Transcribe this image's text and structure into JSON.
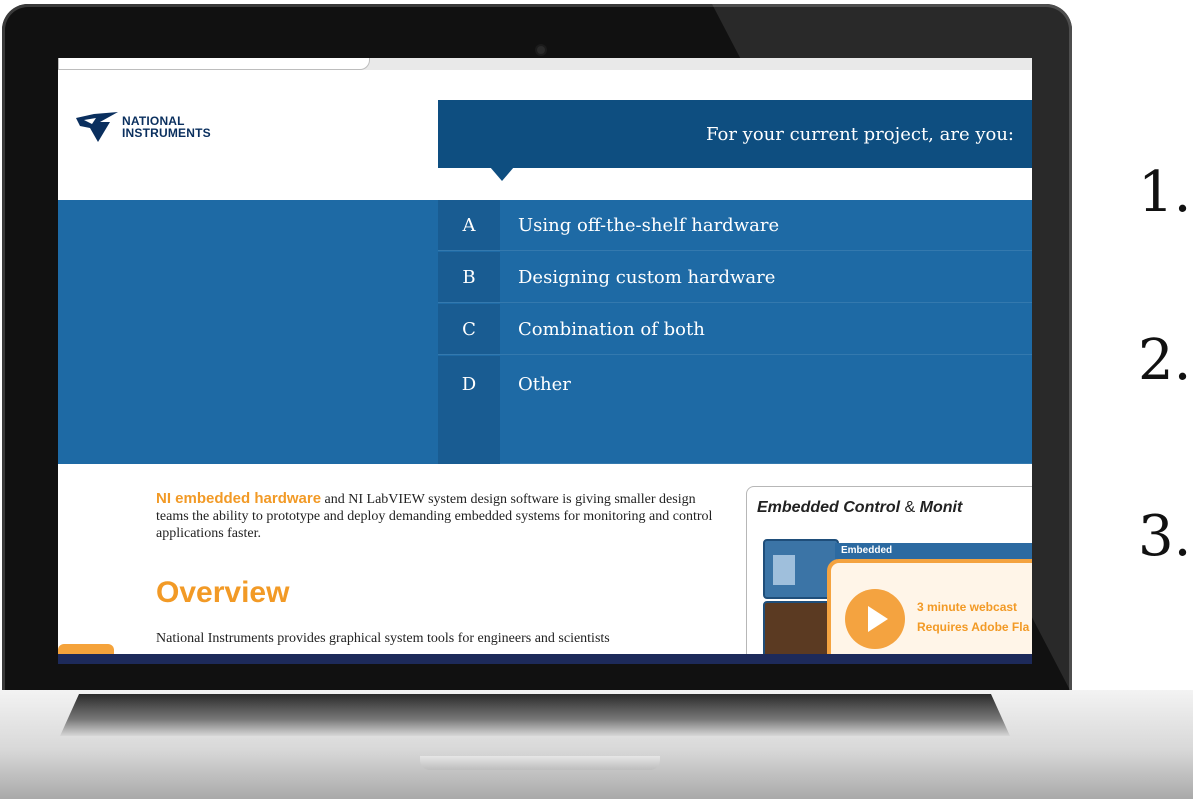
{
  "logo": {
    "line1": "NATIONAL",
    "line2": "INSTRUMENTS"
  },
  "question": {
    "title": "For your current project, are you:"
  },
  "options": [
    {
      "letter": "A",
      "label": "Using off-the-shelf hardware"
    },
    {
      "letter": "B",
      "label": "Designing custom hardware"
    },
    {
      "letter": "C",
      "label": "Combination of both"
    },
    {
      "letter": "D",
      "label": "Other"
    }
  ],
  "intro": {
    "highlight": "NI embedded hardware",
    "text": " and NI LabVIEW system design software is giving smaller design teams the ability to prototype and deploy demanding embedded systems for monitoring and control applications faster."
  },
  "overview": {
    "heading": "Overview",
    "text": "National Instruments provides graphical system tools for engineers and scientists"
  },
  "side_panel": {
    "title_bold": "Embedded Control",
    "title_amp": " & ",
    "title_bold2": "Monit",
    "strip_label": "Embedded",
    "webcast_line1": "3 minute webcast",
    "webcast_line2": "Requires Adobe Fla"
  },
  "numbers": [
    "1.",
    "2.",
    "3."
  ],
  "colors": {
    "question_bar": "#0e4e80",
    "options_band": "#1e6aa5",
    "accent_orange": "#f29a26",
    "brand_navy": "#0a2f5e"
  }
}
